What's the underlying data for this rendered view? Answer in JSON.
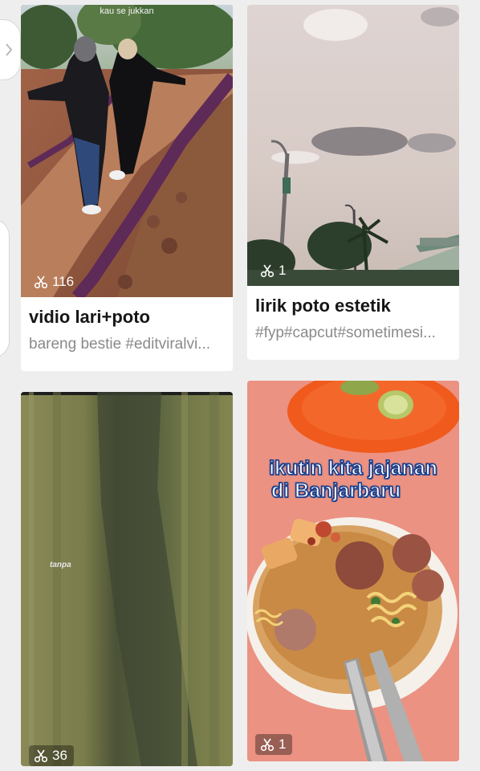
{
  "cards": [
    {
      "title": "vidio lari+poto",
      "description": "bareng bestie #editviralvi...",
      "uses": "116",
      "video_caption": "kau se jukkan"
    },
    {
      "title": "lirik poto estetik",
      "description": "#fyp#capcut#sometimesi...",
      "uses": "1"
    },
    {
      "uses": "36",
      "video_text": "tanpa"
    },
    {
      "uses": "1",
      "overlay_line_1": "ikutin kita jajanan",
      "overlay_line_2": "di Banjarbaru"
    }
  ],
  "icons": {
    "uses": "scissors-icon",
    "side_tab": "chevron-right-icon"
  }
}
